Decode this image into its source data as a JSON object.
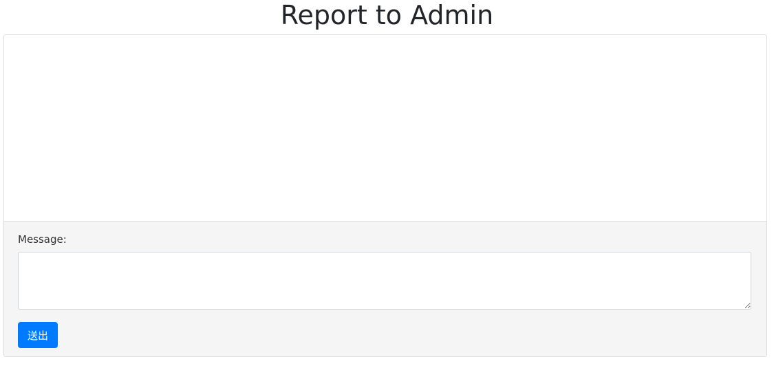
{
  "header": {
    "title": "Report to Admin"
  },
  "form": {
    "message_label": "Message:",
    "message_value": "",
    "submit_label": "送出"
  },
  "colors": {
    "primary_button": "#007bff",
    "footer_background": "#f5f5f5"
  }
}
